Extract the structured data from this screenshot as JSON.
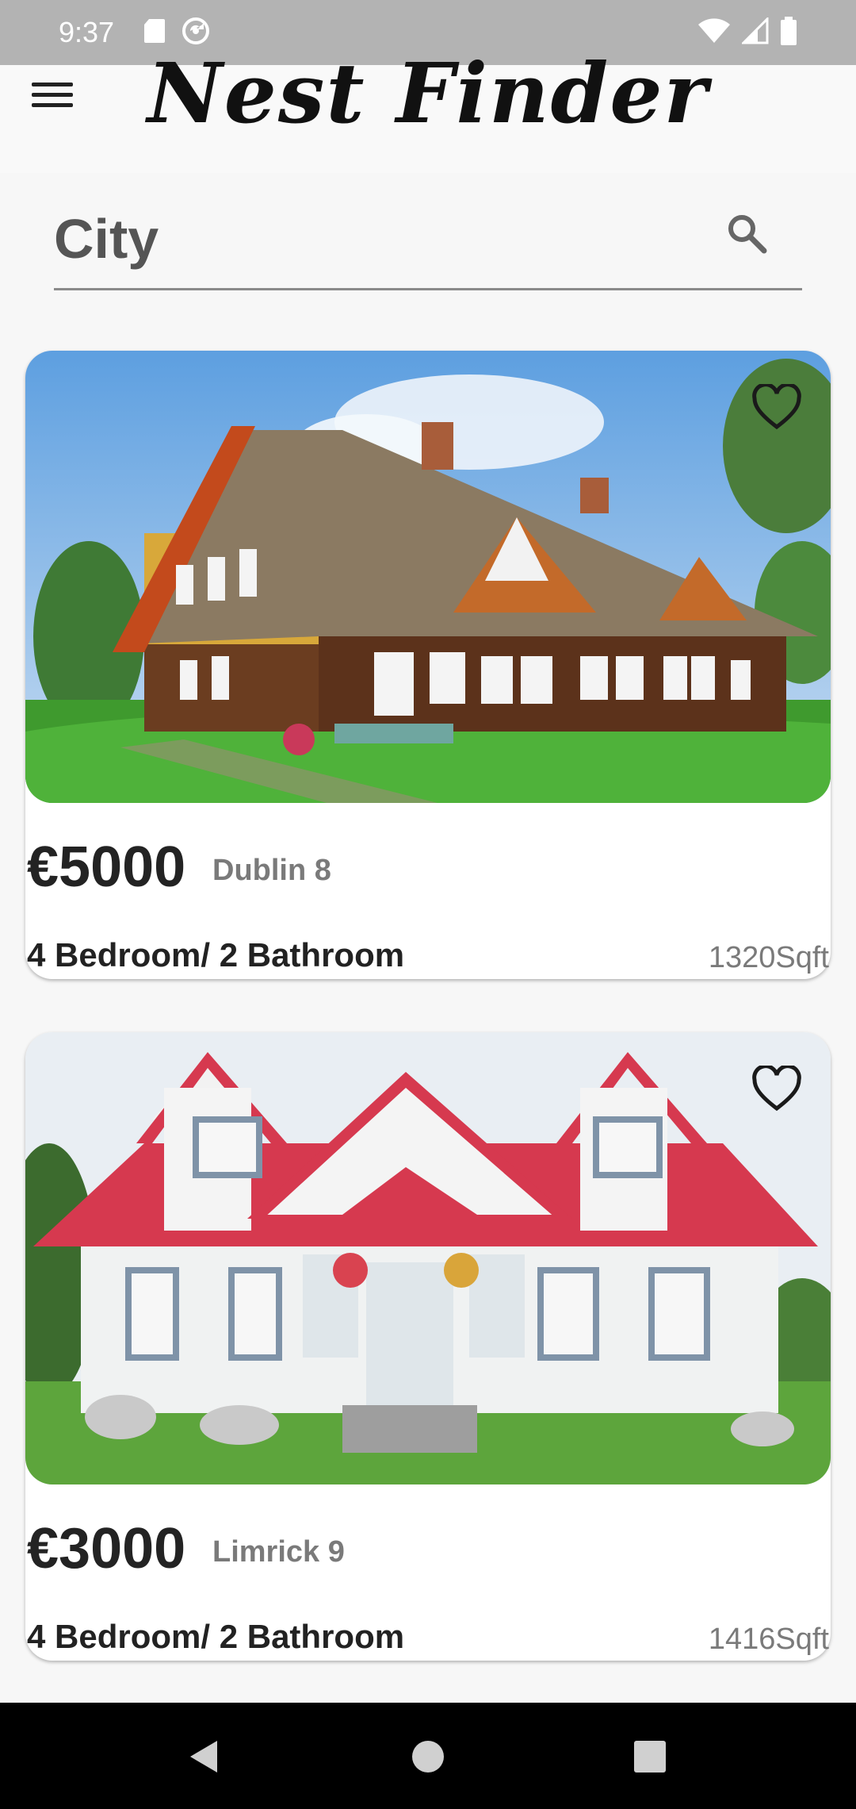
{
  "status_bar": {
    "time": "9:37",
    "icons": [
      "sd-card-icon",
      "sync-icon",
      "wifi-icon",
      "signal-icon",
      "battery-icon"
    ]
  },
  "app_bar": {
    "title": "Nest Finder",
    "menu_icon": "menu-icon"
  },
  "search": {
    "placeholder": "City",
    "icon": "search-icon"
  },
  "listings": [
    {
      "price": "€5000",
      "location": "Dublin 8",
      "rooms": "4 Bedroom/ 2 Bathroom",
      "area": "1320Sqft",
      "image": "thatched-wooden-house-photo",
      "favorite_icon": "heart-outline-icon"
    },
    {
      "price": "€3000",
      "location": "Limrick 9",
      "rooms": "4 Bedroom/ 2 Bathroom",
      "area": "1416Sqft",
      "image": "white-house-red-roof-photo",
      "favorite_icon": "heart-outline-icon"
    }
  ],
  "nav_bar": {
    "buttons": [
      "back-icon",
      "home-icon",
      "recents-icon"
    ]
  },
  "colors": {
    "status_bar": "#b3b3b3",
    "background": "#f7f7f7",
    "card": "#ffffff",
    "nav_bar": "#000000"
  }
}
